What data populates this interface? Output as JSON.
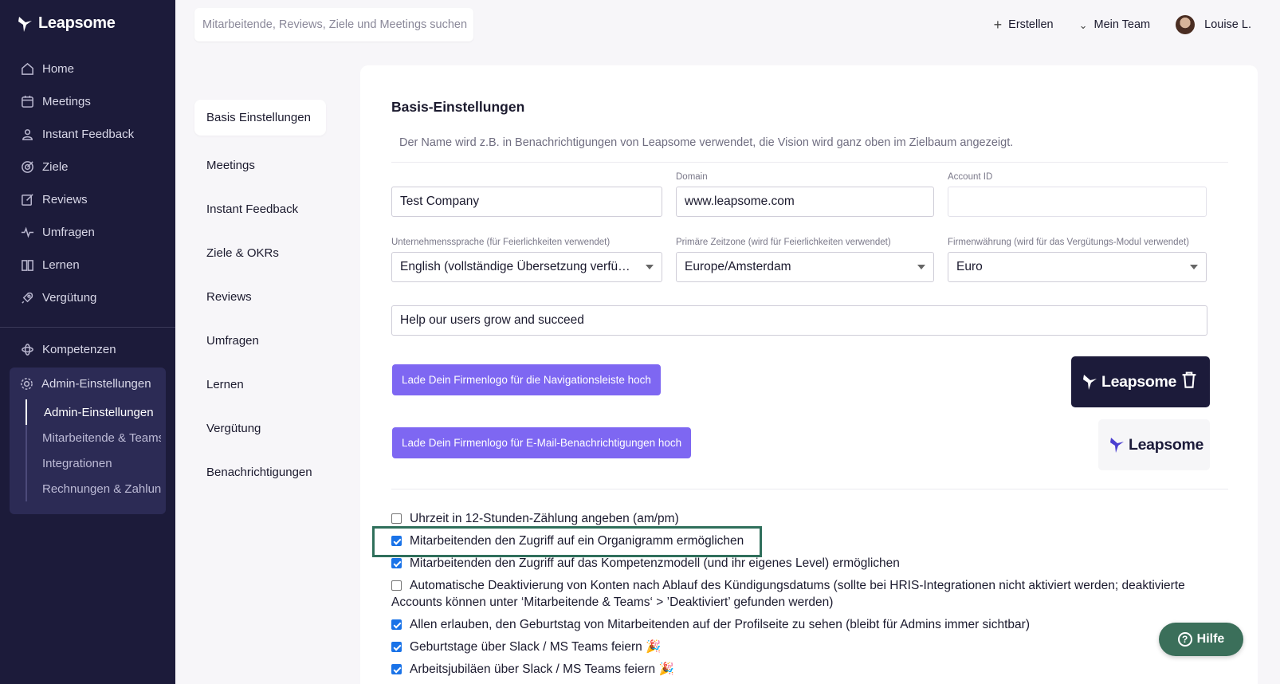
{
  "brand": {
    "name": "Leapsome"
  },
  "sidebar": {
    "items": [
      {
        "label": "Home",
        "icon": "home-icon"
      },
      {
        "label": "Meetings",
        "icon": "calendar-icon"
      },
      {
        "label": "Instant Feedback",
        "icon": "feedback-icon"
      },
      {
        "label": "Ziele",
        "icon": "target-icon"
      },
      {
        "label": "Reviews",
        "icon": "edit-icon"
      },
      {
        "label": "Umfragen",
        "icon": "pulse-icon"
      },
      {
        "label": "Lernen",
        "icon": "book-icon"
      },
      {
        "label": "Vergütung",
        "icon": "rocket-icon"
      }
    ],
    "kompetenzen": "Kompetenzen",
    "admin": {
      "label": "Admin-Einstellungen",
      "sub": [
        "Admin-Einstellungen",
        "Mitarbeitende & Teams",
        "Integrationen",
        "Rechnungen & Zahlungen"
      ]
    }
  },
  "topbar": {
    "search_placeholder": "Mitarbeitende, Reviews, Ziele und Meetings suchen",
    "create": "Erstellen",
    "team": "Mein Team",
    "user": "Louise L."
  },
  "settings_nav": [
    "Basis Einstellungen",
    "Meetings",
    "Instant Feedback",
    "Ziele & OKRs",
    "Reviews",
    "Umfragen",
    "Lernen",
    "Vergütung",
    "Benachrichtigungen"
  ],
  "main": {
    "title": "Basis-Einstellungen",
    "description": "Der Name wird z.B. in Benachrichtigungen von Leapsome verwendet, die Vision wird ganz oben im Zielbaum angezeigt.",
    "company_name": "Test Company",
    "domain_label": "Domain",
    "domain": "www.leapsome.com",
    "account_id_label": "Account ID",
    "account_id": "",
    "language_label": "Unternehmenssprache (für Feierlichkeiten verwendet)",
    "language": "English (vollständige Übersetzung verfügbar)",
    "timezone_label": "Primäre Zeitzone (wird für Feierlichkeiten verwendet)",
    "timezone": "Europe/Amsterdam",
    "currency_label": "Firmenwährung (wird für das Vergütungs-Modul verwendet)",
    "currency": "Euro",
    "vision": "Help our users grow and succeed",
    "upload_nav_logo": "Lade Dein Firmenlogo für die Navigationsleiste hoch",
    "upload_email_logo": "Lade Dein Firmenlogo für E-Mail-Benachrichtigungen hoch"
  },
  "checkboxes": [
    {
      "label": "Uhrzeit in 12-Stunden-Zählung angeben (am/pm)",
      "checked": false
    },
    {
      "label": "Mitarbeitenden den Zugriff auf ein Organigramm ermöglichen",
      "checked": true
    },
    {
      "label": "Mitarbeitenden den Zugriff auf das Kompetenzmodell (und ihr eigenes Level) ermöglichen",
      "checked": true
    },
    {
      "label": "Automatische Deaktivierung von Konten nach Ablauf des Kündigungsdatums (sollte bei HRIS-Integrationen nicht aktiviert werden; deaktivierte Accounts können unter ‘Mitarbeitende & Teams‘ > ’Deaktiviert’ gefunden werden)",
      "checked": false
    },
    {
      "label": "Allen erlauben, den Geburtstag von Mitarbeitenden auf der Profilseite zu sehen (bleibt für Admins immer sichtbar)",
      "checked": true
    },
    {
      "label": "Geburtstage über Slack / MS Teams feiern 🎉",
      "checked": true
    },
    {
      "label": "Arbeitsjubiläen über Slack / MS Teams feiern 🎉",
      "checked": true
    }
  ],
  "help": "Hilfe",
  "colors": {
    "sidebar": "#1c1b3a",
    "accent": "#7e67f2",
    "help": "#3b6f5a",
    "highlight": "#2f6f5b"
  }
}
